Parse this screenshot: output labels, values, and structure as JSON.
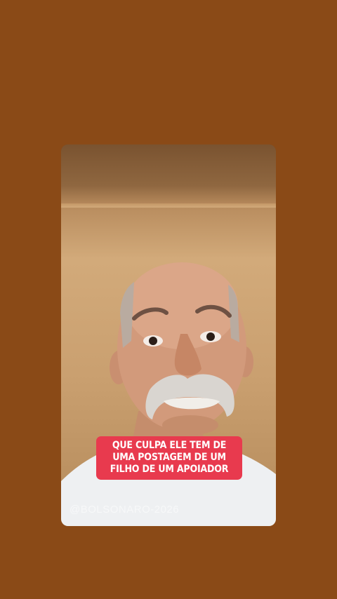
{
  "caption": {
    "lines": [
      "QUE CULPA ELE TEM DE",
      "UMA POSTAGEM DE UM",
      "FILHO DE UM APOIADOR"
    ]
  },
  "watermark": "@BOLSONARO-2026",
  "colors": {
    "page_background": "#8a4a17",
    "caption_background": "#e83a4e",
    "caption_text": "#ffffff"
  }
}
